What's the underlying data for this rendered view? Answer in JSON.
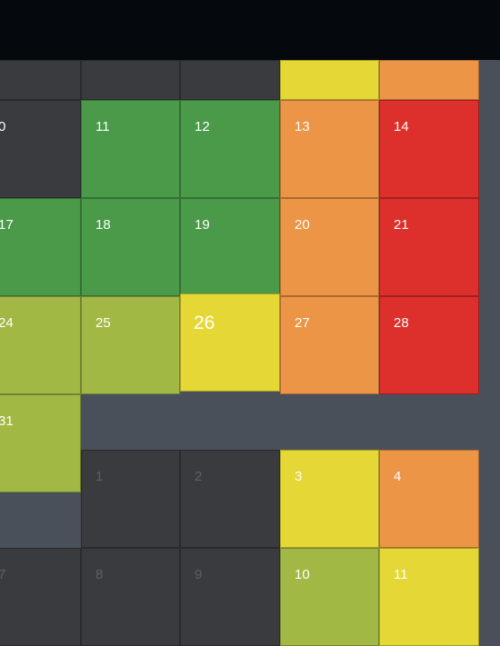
{
  "colors": {
    "background": "#4a5059",
    "empty_cell": "#3a3b3f",
    "green": "#4a9a4a",
    "yellow_green": "#a1b845",
    "yellow": "#e5d735",
    "orange": "#ec9546",
    "red": "#dd2f2b",
    "header": "#05080c"
  },
  "calendar": {
    "today": "26",
    "days": [
      {
        "label": "",
        "status": "empty"
      },
      {
        "label": "",
        "status": "empty"
      },
      {
        "label": "",
        "status": "empty"
      },
      {
        "label": "",
        "status": "yellow"
      },
      {
        "label": "",
        "status": "orange"
      },
      {
        "label": "0",
        "status": "empty"
      },
      {
        "label": "11",
        "status": "green"
      },
      {
        "label": "12",
        "status": "green"
      },
      {
        "label": "13",
        "status": "orange"
      },
      {
        "label": "14",
        "status": "red"
      },
      {
        "label": "17",
        "status": "green"
      },
      {
        "label": "18",
        "status": "green"
      },
      {
        "label": "19",
        "status": "green"
      },
      {
        "label": "20",
        "status": "orange"
      },
      {
        "label": "21",
        "status": "red"
      },
      {
        "label": "24",
        "status": "yellow_green"
      },
      {
        "label": "25",
        "status": "yellow_green"
      },
      {
        "label": "26",
        "status": "yellow"
      },
      {
        "label": "27",
        "status": "orange"
      },
      {
        "label": "28",
        "status": "red"
      },
      {
        "label": "31",
        "status": "yellow_green"
      },
      {
        "label": "1",
        "status": "empty_dim"
      },
      {
        "label": "2",
        "status": "empty_dim"
      },
      {
        "label": "3",
        "status": "yellow"
      },
      {
        "label": "4",
        "status": "orange"
      },
      {
        "label": "7",
        "status": "empty_dim"
      },
      {
        "label": "8",
        "status": "empty_dim"
      },
      {
        "label": "9",
        "status": "empty_dim"
      },
      {
        "label": "10",
        "status": "yellow_green"
      },
      {
        "label": "11",
        "status": "yellow"
      }
    ]
  }
}
